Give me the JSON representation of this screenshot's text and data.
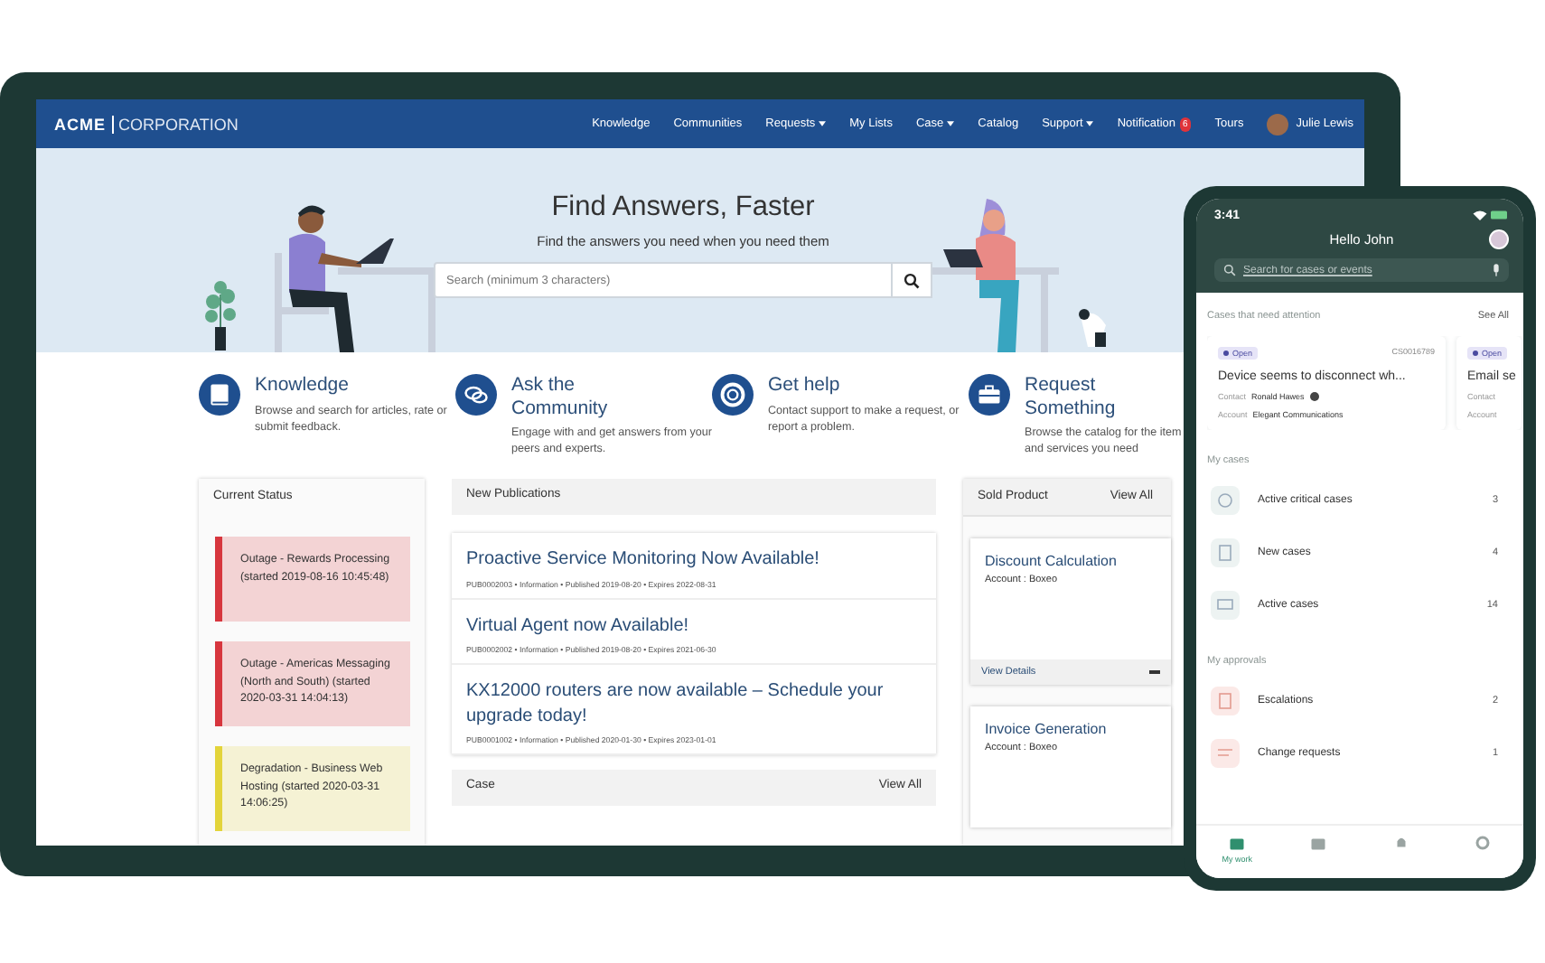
{
  "tablet": {
    "logo": {
      "brand": "ACME",
      "suffix": "CORPORATION"
    },
    "nav": [
      {
        "label": "Knowledge",
        "dropdown": false
      },
      {
        "label": "Communities",
        "dropdown": false
      },
      {
        "label": "Requests",
        "dropdown": true
      },
      {
        "label": "My Lists",
        "dropdown": false
      },
      {
        "label": "Case",
        "dropdown": true
      },
      {
        "label": "Catalog",
        "dropdown": false
      },
      {
        "label": "Support",
        "dropdown": true
      },
      {
        "label": "Notification",
        "dropdown": false,
        "badge": "6"
      },
      {
        "label": "Tours",
        "dropdown": false
      }
    ],
    "user": {
      "name": "Julie Lewis"
    },
    "hero": {
      "title": "Find Answers, Faster",
      "subtitle": "Find the answers you need when you need them",
      "search": {
        "placeholder": "Search (minimum 3 characters)"
      }
    },
    "features": [
      {
        "kind": "book",
        "title": "Knowledge",
        "text": "Browse and search for articles, rate or submit feedback."
      },
      {
        "kind": "chat",
        "title": "Ask the Community",
        "text": "Engage with and get answers from your peers and experts."
      },
      {
        "kind": "lifebuoy",
        "title": "Get help",
        "text": "Contact support to make a request, or report a problem."
      },
      {
        "kind": "briefcase",
        "title": "Request Something",
        "text": "Browse the catalog for the item and services you need"
      }
    ],
    "current_status": {
      "title": "Current Status",
      "items": [
        {
          "text": "Outage - Rewards Processing (started 2019-08-16 10:45:48)",
          "color": "#d7363e"
        },
        {
          "text": "Outage - Americas Messaging (North and South) (started 2020-03-31 14:04:13)",
          "color": "#d7363e"
        },
        {
          "text": "Degradation - Business Web Hosting (started 2020-03-31 14:06:25)",
          "color": "#e3d43a"
        }
      ]
    },
    "publications": {
      "title": "New Publications",
      "items": [
        {
          "title": "Proactive Service Monitoring Now Available!",
          "meta": "PUB0002003 • Information • Published 2019-08-20 • Expires 2022-08-31"
        },
        {
          "title": "Virtual Agent now Available!",
          "meta": "PUB0002002 • Information • Published 2019-08-20 • Expires 2021-06-30"
        },
        {
          "title": "KX12000 routers are now available – Schedule your upgrade today!",
          "meta": "PUB0001002 • Information • Published 2020-01-30 • Expires 2023-01-01"
        }
      ]
    },
    "case": {
      "title": "Case",
      "link": "View All"
    },
    "sold_product": {
      "title": "Sold Product",
      "link": "View All",
      "items": [
        {
          "title": "Discount Calculation",
          "account": "Account : Boxeo",
          "details": "View Details"
        },
        {
          "title": "Invoice Generation",
          "account": "Account : Boxeo"
        }
      ]
    }
  },
  "phone": {
    "time": "3:41",
    "greeting": "Hello John",
    "search": {
      "placeholder": "Search for cases or events"
    },
    "attention": {
      "title": "Cases that need attention",
      "link": "See All",
      "cards": [
        {
          "status": "Open",
          "number": "CS0016789",
          "title": "Device seems to disconnect wh...",
          "contact_label": "Contact",
          "contact": "Ronald Hawes",
          "account_label": "Account",
          "account": "Elegant Communications"
        },
        {
          "status": "Open",
          "title": "Email se",
          "contact_label": "Contact",
          "account_label": "Account"
        }
      ]
    },
    "sections": [
      {
        "title": "My cases",
        "rows": [
          {
            "kind": "clock",
            "label": "Active critical cases",
            "count": "3"
          },
          {
            "kind": "clipboard",
            "label": "New cases",
            "count": "4"
          },
          {
            "kind": "monitor",
            "label": "Active cases",
            "count": "14"
          }
        ]
      },
      {
        "title": "My approvals",
        "rows": [
          {
            "kind": "alert",
            "label": "Escalations",
            "count": "2"
          },
          {
            "kind": "form",
            "label": "Change requests",
            "count": "1"
          }
        ]
      }
    ],
    "tabs": [
      {
        "kind": "work",
        "label": "My work",
        "selected": true
      },
      {
        "kind": "case",
        "selected": false
      },
      {
        "kind": "bell",
        "selected": false
      },
      {
        "kind": "gear",
        "selected": false
      }
    ]
  }
}
